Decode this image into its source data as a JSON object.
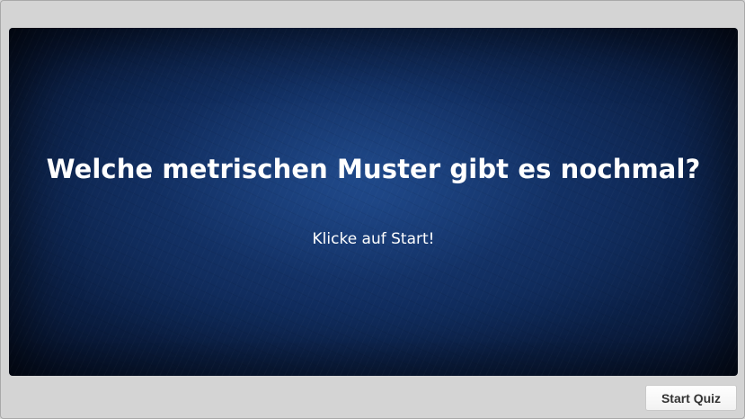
{
  "slide": {
    "title": "Welche metrischen Muster gibt es nochmal?",
    "subtitle": "Klicke auf Start!"
  },
  "controls": {
    "start_label": "Start Quiz"
  },
  "colors": {
    "background_frame": "#d4d4d4",
    "slide_background": "#0f2a59",
    "text": "#ffffff"
  }
}
